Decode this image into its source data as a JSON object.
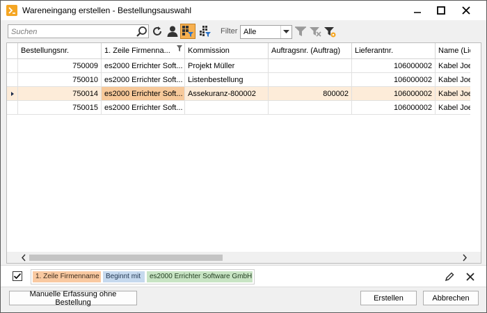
{
  "window": {
    "title": "Wareneingang erstellen - Bestellungsauswahl"
  },
  "toolbar": {
    "search_placeholder": "Suchen",
    "filter_label": "Filter",
    "filter_value": "Alle",
    "icons": [
      "search-icon",
      "refresh-icon",
      "person-icon",
      "grid-filter-icon",
      "grid-multi-icon",
      "filter-icon",
      "filter-clear-icon",
      "filter-settings-icon"
    ]
  },
  "grid": {
    "columns": [
      {
        "label": "Bestellungsnr."
      },
      {
        "label": "1. Zeile Firmenna..."
      },
      {
        "label": "Kommission"
      },
      {
        "label": "Auftragsnr. (Auftrag)"
      },
      {
        "label": "Lieferantnr."
      },
      {
        "label": "Name (Lie"
      }
    ],
    "rows": [
      {
        "cells": [
          "750009",
          "es2000 Errichter Soft...",
          "Projekt Müller",
          "",
          "106000002",
          "Kabel Joe"
        ]
      },
      {
        "cells": [
          "750010",
          "es2000 Errichter Soft...",
          "Listenbestellung",
          "",
          "106000002",
          "Kabel Joe"
        ]
      },
      {
        "cells": [
          "750014",
          "es2000 Errichter Soft...",
          "Assekuranz-800002",
          "800002",
          "106000002",
          "Kabel Joe"
        ]
      },
      {
        "cells": [
          "750015",
          "es2000 Errichter Soft...",
          "",
          "",
          "106000002",
          "Kabel Joe"
        ]
      }
    ],
    "selected_row_index": 2
  },
  "filterbar": {
    "checked": true,
    "chips": [
      "1. Zeile Firmenname",
      "Beginnt mit",
      "es2000 Errichter Software GmbH"
    ]
  },
  "buttons": {
    "manual": "Manuelle Erfassung ohne Bestellung",
    "create": "Erstellen",
    "cancel": "Abbrechen"
  },
  "colors": {
    "accent": "#f7b04f",
    "selected_row": "#fdecd9",
    "chip_field": "#f9c9a1",
    "chip_operator": "#c6d9ee",
    "chip_value": "#c8e4c4"
  }
}
